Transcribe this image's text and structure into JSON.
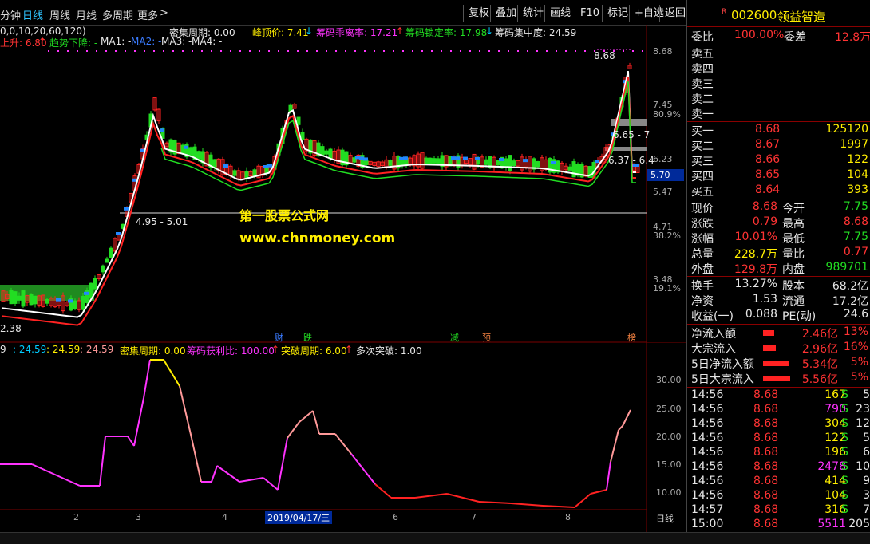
{
  "toolbar": {
    "periods": [
      "分钟",
      "日线",
      "周线",
      "月线",
      "多周期",
      "更多"
    ],
    "active_period": "日线",
    "buttons": [
      "复权",
      "叠加",
      "统计",
      "画线",
      "F10",
      "标记",
      "+自选",
      "返回"
    ],
    "more_arrow": ">"
  },
  "main_indicators": {
    "row1_left": "0,0,10,20,60,120)",
    "density_period": "密集周期: 0.00",
    "peak_price": "峰顶价: 7.41",
    "peak_arrow": "↓",
    "chip_deviation": "筹码乖离率: 17.21",
    "chip_deviation_arrow": "↑",
    "chip_lock": "筹码锁定率: 17.98",
    "chip_lock_arrow": "↓",
    "chip_concentration": "筹码集中度: 24.59",
    "row2_rise": "上升: 6.80",
    "row2_rise_arrow": "↑",
    "row2_trend": "趋势下降: -",
    "ma1": "MA1: -",
    "ma2": "MA2: -",
    "ma3": "MA3: -",
    "ma4": "MA4: -"
  },
  "main_axis": [
    "8.68",
    "7.45",
    "80.9%",
    "6.23",
    "5.70",
    "5.47",
    "4.71",
    "38.2%",
    "3.48",
    "19.1%"
  ],
  "main_annotations": {
    "high_label": "8.68",
    "low_label": "2.38",
    "line_label": "4.95 - 5.01",
    "box1_label": "6.65 - 7",
    "box2_label": "6.37 - 6.4",
    "price_marker": "5.70"
  },
  "watermark": {
    "title": "第一股票公式网",
    "url": "www.chnmoney.com"
  },
  "event_markers": [
    "财",
    "跌",
    "减",
    "预",
    "榜"
  ],
  "sub_indicators": {
    "v1": ": 24.59",
    "v2": ": 24.59",
    "v3": ": 24.59",
    "density": "密集周期: 0.00",
    "chip_profit": "筹码获利比: 100.00",
    "chip_profit_arrow": "↑",
    "break_period": "突破周期: 6.00",
    "break_arrow": "↑",
    "multi_break": "多次突破: 1.00",
    "lead": "9"
  },
  "sub_axis": [
    "30.00",
    "25.00",
    "20.00",
    "15.00",
    "10.00"
  ],
  "x_axis": [
    "2",
    "3",
    "4",
    "2019/04/17/三",
    "6",
    "7",
    "8"
  ],
  "x_axis_right": "日线",
  "stock": {
    "badge": "R",
    "code": "002600",
    "name": "领益智造"
  },
  "ratio": {
    "label1": "委比",
    "value1": "100.00%",
    "label2": "委差",
    "value2": "12.8万"
  },
  "sell_levels": [
    "卖五",
    "卖四",
    "卖三",
    "卖二",
    "卖一"
  ],
  "buy_levels": [
    {
      "label": "买一",
      "price": "8.68",
      "vol": "125120"
    },
    {
      "label": "买二",
      "price": "8.67",
      "vol": "1997"
    },
    {
      "label": "买三",
      "price": "8.66",
      "vol": "122"
    },
    {
      "label": "买四",
      "price": "8.65",
      "vol": "104"
    },
    {
      "label": "买五",
      "price": "8.64",
      "vol": "393"
    }
  ],
  "quote": [
    {
      "l1": "现价",
      "v1": "8.68",
      "l2": "今开",
      "v2": "7.75"
    },
    {
      "l1": "涨跌",
      "v1": "0.79",
      "l2": "最高",
      "v2": "8.68"
    },
    {
      "l1": "涨幅",
      "v1": "10.01%",
      "l2": "最低",
      "v2": "7.75"
    },
    {
      "l1": "总量",
      "v1": "228.7万",
      "l2": "量比",
      "v2": "0.77"
    },
    {
      "l1": "外盘",
      "v1": "129.8万",
      "l2": "内盘",
      "v2": "989701"
    }
  ],
  "fundamentals": [
    {
      "l1": "换手",
      "v1": "13.27%",
      "l2": "股本",
      "v2": "68.2亿"
    },
    {
      "l1": "净资",
      "v1": "1.53",
      "l2": "流通",
      "v2": "17.2亿"
    },
    {
      "l1": "收益(一)",
      "v1": "0.088",
      "l2": "PE(动)",
      "v2": "24.6"
    }
  ],
  "flows": [
    {
      "label": "净流入额",
      "value": "2.46亿",
      "pct": "13%",
      "bar": 0.35
    },
    {
      "label": "大宗流入",
      "value": "2.96亿",
      "pct": "16%",
      "bar": 0.4
    },
    {
      "label": "5日净流入额",
      "value": "5.34亿",
      "pct": "5%",
      "bar": 0.8
    },
    {
      "label": "5日大宗流入",
      "value": "5.56亿",
      "pct": "5%",
      "bar": 0.85
    }
  ],
  "ticks": [
    {
      "time": "14:56",
      "price": "8.68",
      "vol": "167",
      "side": "S",
      "n": "5"
    },
    {
      "time": "14:56",
      "price": "8.68",
      "vol": "790",
      "side": "S",
      "n": "23"
    },
    {
      "time": "14:56",
      "price": "8.68",
      "vol": "304",
      "side": "S",
      "n": "12"
    },
    {
      "time": "14:56",
      "price": "8.68",
      "vol": "122",
      "side": "S",
      "n": "5"
    },
    {
      "time": "14:56",
      "price": "8.68",
      "vol": "196",
      "side": "S",
      "n": "6"
    },
    {
      "time": "14:56",
      "price": "8.68",
      "vol": "2478",
      "side": "S",
      "n": "10"
    },
    {
      "time": "14:56",
      "price": "8.68",
      "vol": "414",
      "side": "S",
      "n": "9"
    },
    {
      "time": "14:56",
      "price": "8.68",
      "vol": "104",
      "side": "S",
      "n": "3"
    },
    {
      "time": "14:57",
      "price": "8.68",
      "vol": "316",
      "side": "S",
      "n": "7"
    },
    {
      "time": "15:00",
      "price": "8.68",
      "vol": "5511",
      "side": "",
      "n": "205"
    }
  ],
  "colors": {
    "up": "#ff3333",
    "down": "#22dd22",
    "accent": "#ffee00",
    "magenta": "#ff33ff",
    "cyan": "#00ccff"
  }
}
